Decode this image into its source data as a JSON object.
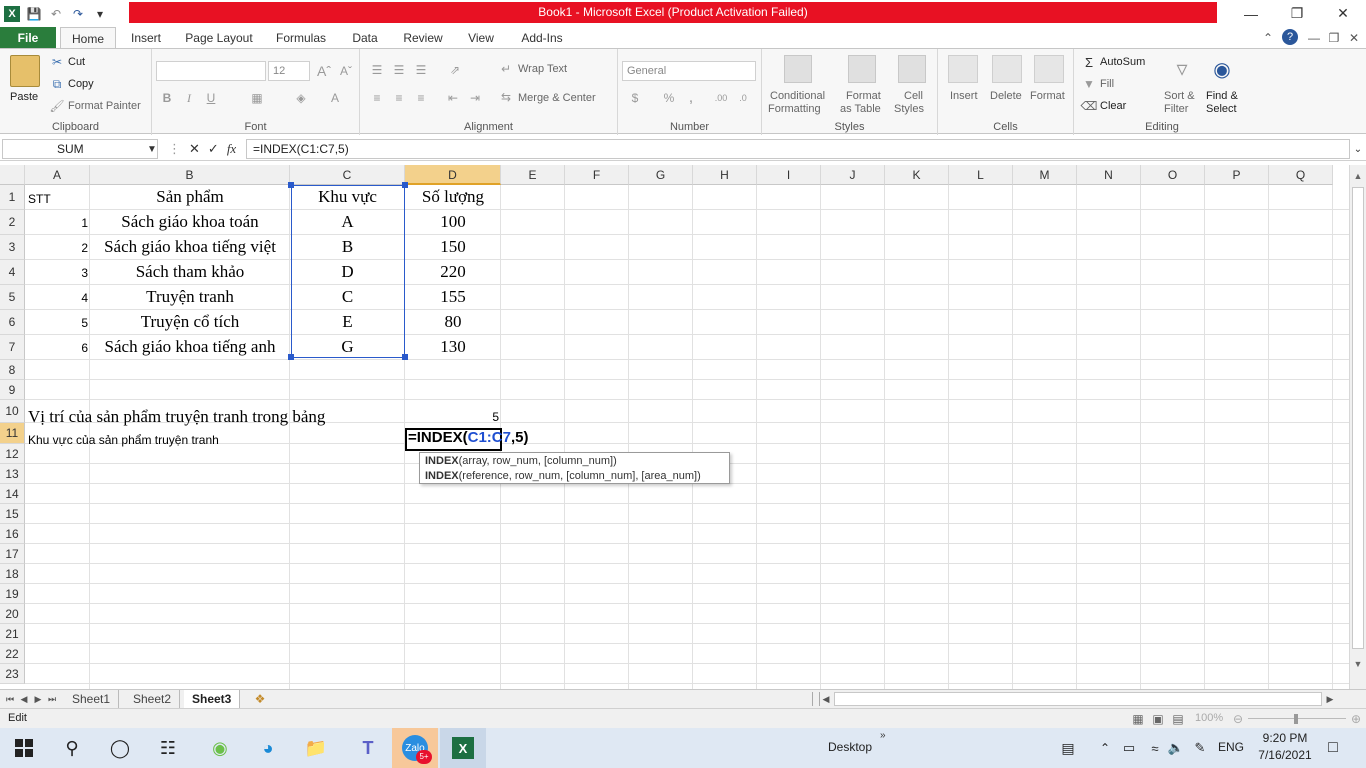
{
  "window": {
    "title": "Book1 - Microsoft Excel (Product Activation Failed)",
    "minimize": "—",
    "restore": "❐",
    "close": "✕"
  },
  "tabs": [
    "File",
    "Home",
    "Insert",
    "Page Layout",
    "Formulas",
    "Data",
    "Review",
    "View",
    "Add-Ins"
  ],
  "ribbon": {
    "clipboard": {
      "paste": "Paste",
      "cut": "Cut",
      "copy": "Copy",
      "format_painter": "Format Painter",
      "label": "Clipboard"
    },
    "font": {
      "size": "12",
      "bold": "B",
      "italic": "I",
      "underline": "U",
      "label": "Font"
    },
    "alignment": {
      "wrap": "Wrap Text",
      "merge": "Merge & Center",
      "label": "Alignment"
    },
    "number": {
      "format": "General",
      "label": "Number"
    },
    "styles": {
      "conditional": "Conditional",
      "formatting": "Formatting",
      "format": "Format",
      "as_table": "as Table",
      "cell": "Cell",
      "styles": "Styles",
      "label": "Styles"
    },
    "cells": {
      "insert": "Insert",
      "delete": "Delete",
      "format": "Format",
      "label": "Cells"
    },
    "editing": {
      "autosum": "AutoSum",
      "fill": "Fill",
      "clear": "Clear",
      "sort": "Sort &",
      "filter": "Filter",
      "find": "Find &",
      "select": "Select",
      "label": "Editing"
    }
  },
  "formula_bar": {
    "name_box": "SUM",
    "cancel": "✕",
    "enter": "✓",
    "fx": "fx",
    "formula": "=INDEX(C1:C7,5)"
  },
  "columns": [
    "A",
    "B",
    "C",
    "D",
    "E",
    "F",
    "G",
    "H",
    "I",
    "J",
    "K",
    "L",
    "M",
    "N",
    "O",
    "P",
    "Q"
  ],
  "rows": [
    "1",
    "2",
    "3",
    "4",
    "5",
    "6",
    "7",
    "8",
    "9",
    "10",
    "11",
    "12",
    "13",
    "14",
    "15",
    "16",
    "17",
    "18",
    "19",
    "20",
    "21",
    "22",
    "23"
  ],
  "cells": {
    "A1": "STT",
    "B1": "Sản phẩm",
    "C1": "Khu vực",
    "D1": "Số lượng",
    "A2": "1",
    "B2": "Sách giáo khoa toán",
    "C2": "A",
    "D2": "100",
    "A3": "2",
    "B3": "Sách giáo khoa tiếng việt",
    "C3": "B",
    "D3": "150",
    "A4": "3",
    "B4": "Sách tham khảo",
    "C4": "D",
    "D4": "220",
    "A5": "4",
    "B5": "Truyện tranh",
    "C5": "C",
    "D5": "155",
    "A6": "5",
    "B6": "Truyện cổ tích",
    "C6": "E",
    "D6": "80",
    "A7": "6",
    "B7": "Sách giáo khoa tiếng anh",
    "C7": "G",
    "D7": "130",
    "A10": "Vị trí của sản phẩm truyện tranh trong bảng",
    "D10": "5",
    "A11": "Khu vực của sản phẩm truyện tranh",
    "D11_pre": "=INDEX(",
    "D11_ref": "C1:C7",
    "D11_post": ",5)"
  },
  "tooltip": {
    "line1_fn": "INDEX",
    "line1_args": "(array, row_num, [column_num])",
    "line2_fn": "INDEX",
    "line2_args": "(reference, row_num, [column_num], [area_num])"
  },
  "sheets": [
    "Sheet1",
    "Sheet2",
    "Sheet3"
  ],
  "active_sheet": "Sheet3",
  "status": {
    "mode": "Edit",
    "zoom": "100%"
  },
  "taskbar": {
    "desktop": "Desktop",
    "lang": "ENG",
    "time": "9:20 PM",
    "date": "7/16/2021",
    "badge": "5+"
  },
  "colors": {
    "title_red": "#e81123",
    "file_green": "#2a7d3c",
    "ref_blue": "#1f4fd1",
    "taskbar": "#dfe8f3"
  }
}
